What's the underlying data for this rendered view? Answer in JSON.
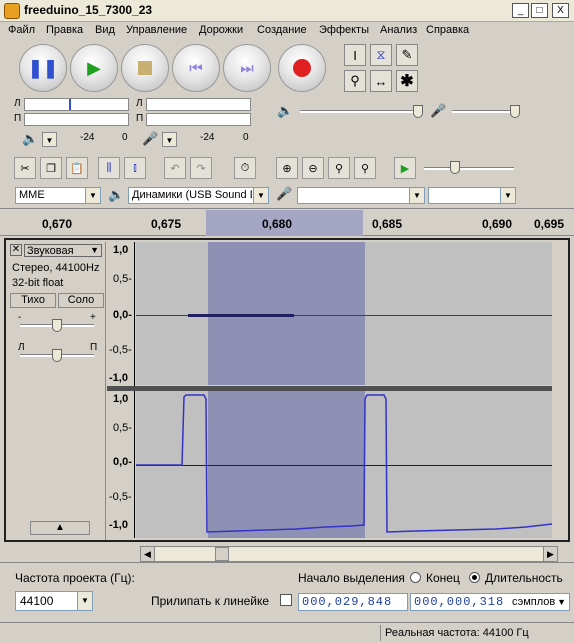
{
  "window": {
    "title": "freeduino_15_7300_23",
    "minimize": "_",
    "maximize": "□",
    "close": "X"
  },
  "menu": [
    "Файл",
    "Правка",
    "Вид",
    "Управление",
    "Дорожки",
    "Создание",
    "Эффекты",
    "Анализ",
    "Справка"
  ],
  "meters": {
    "left_ch": "Л",
    "right_ch": "П",
    "scale_left": [
      "-24",
      "0"
    ],
    "scale_right": [
      "-24",
      "0"
    ]
  },
  "devices": {
    "host": "MME",
    "output": "Динамики (USB Sound De",
    "input": "",
    "channels": ""
  },
  "ruler": {
    "ticks": [
      "0,670",
      "0,675",
      "0,680",
      "0,685",
      "0,690",
      "0,695"
    ]
  },
  "track": {
    "name": "Звуковая",
    "info1": "Стерео, 44100Hz",
    "info2": "32-bit float",
    "mute": "Тихо",
    "solo": "Соло",
    "gain_minus": "-",
    "gain_plus": "+",
    "pan_left": "Л",
    "pan_right": "П",
    "ch1_labels": [
      "1,0",
      "0,5-",
      "0,0-",
      "-0,5-",
      "-1,0"
    ],
    "ch2_labels": [
      "1,0",
      "0,5-",
      "0,0-",
      "-0,5-",
      "-1,0"
    ]
  },
  "bottom": {
    "rate_label": "Частота проекта (Гц):",
    "rate_value": "44100",
    "snap_label": "Прилипать к линейке",
    "sel_start_label": "Начало выделения",
    "end_label": "Конец",
    "length_label": "Длительность",
    "start_time": "000,029,848",
    "length_time": "000,000,318",
    "unit": "сэмплов"
  },
  "status": {
    "actual_rate": "Реальная частота: 44100 Гц"
  },
  "colors": {
    "selection": "#8f91b4",
    "wave": "#3232c8",
    "track_bg": "#c0c0c0"
  }
}
